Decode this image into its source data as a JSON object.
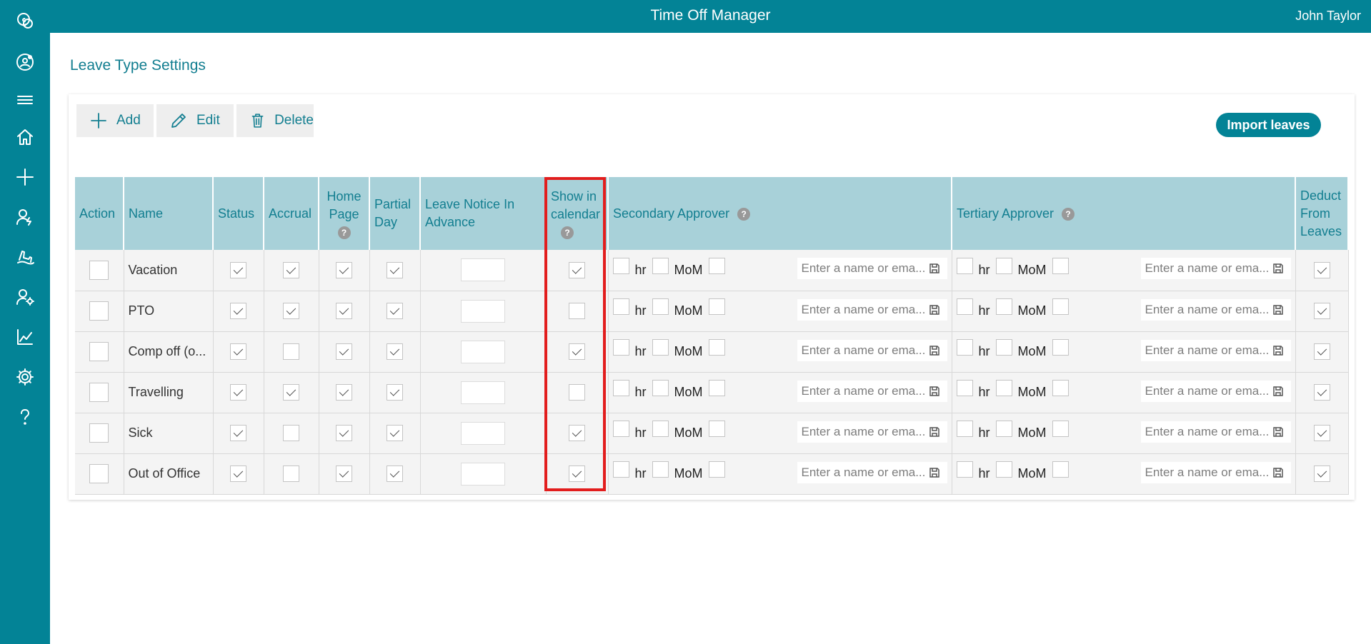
{
  "app": {
    "title": "Time Off Manager",
    "user": "John Taylor"
  },
  "sidebar": {
    "items": [
      {
        "name": "sharepoint-icon"
      },
      {
        "name": "teams-icon"
      },
      {
        "name": "menu-icon"
      },
      {
        "name": "home-icon"
      },
      {
        "name": "add-icon"
      },
      {
        "name": "user-leave-icon"
      },
      {
        "name": "travel-icon"
      },
      {
        "name": "user-settings-icon"
      },
      {
        "name": "chart-icon"
      },
      {
        "name": "gear-icon"
      },
      {
        "name": "help-icon"
      }
    ]
  },
  "page": {
    "title": "Leave Type Settings"
  },
  "toolbar": {
    "add": "Add",
    "edit": "Edit",
    "delete": "Delete",
    "import": "Import leaves"
  },
  "table": {
    "headers": {
      "action": "Action",
      "name": "Name",
      "status": "Status",
      "accrual": "Accrual",
      "home_page": "Home Page",
      "partial_day": "Partial Day",
      "leave_notice": "Leave Notice In Advance",
      "show_in_calendar": "Show in calendar",
      "secondary_approver": "Secondary Approver",
      "tertiary_approver": "Tertiary Approver",
      "deduct": "Deduct From Leaves"
    },
    "help_glyph": "?",
    "approver_labels": {
      "hr": "hr",
      "mom": "MoM"
    },
    "picker_placeholder": "Enter a name or ema...",
    "rows": [
      {
        "name": "Vacation",
        "status": true,
        "accrual": true,
        "home": true,
        "partial": true,
        "calendar": true,
        "deduct": true
      },
      {
        "name": "PTO",
        "status": true,
        "accrual": true,
        "home": true,
        "partial": true,
        "calendar": false,
        "deduct": true
      },
      {
        "name": "Comp off (o...",
        "status": true,
        "accrual": false,
        "home": true,
        "partial": true,
        "calendar": true,
        "deduct": true
      },
      {
        "name": "Travelling",
        "status": true,
        "accrual": true,
        "home": true,
        "partial": true,
        "calendar": false,
        "deduct": true
      },
      {
        "name": "Sick",
        "status": true,
        "accrual": false,
        "home": true,
        "partial": true,
        "calendar": true,
        "deduct": true
      },
      {
        "name": "Out of Office",
        "status": true,
        "accrual": false,
        "home": true,
        "partial": true,
        "calendar": true,
        "deduct": true
      }
    ]
  },
  "colors": {
    "brand": "#038396",
    "header_bg": "#a8d1d9",
    "header_text": "#127e90",
    "highlight": "#e21d1d"
  }
}
